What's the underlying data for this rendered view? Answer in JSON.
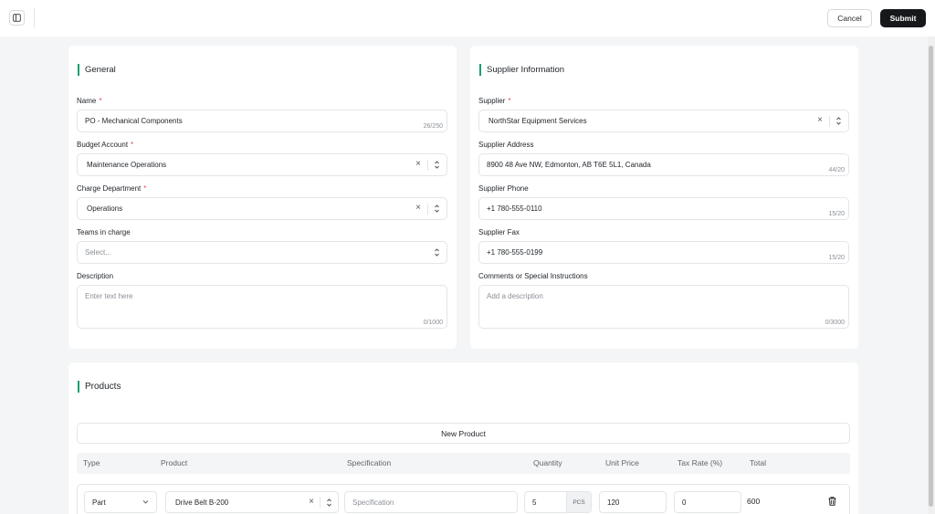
{
  "toolbar": {
    "cancel_label": "Cancel",
    "submit_label": "Submit"
  },
  "general": {
    "title": "General",
    "name": {
      "label": "Name",
      "value": "PO - Mechanical Components",
      "counter": "26/250"
    },
    "budget_account": {
      "label": "Budget Account",
      "value": "Maintenance Operations"
    },
    "charge_department": {
      "label": "Charge Department",
      "value": "Operations"
    },
    "teams": {
      "label": "Teams in charge",
      "placeholder": "Select..."
    },
    "description": {
      "label": "Description",
      "placeholder": "Enter text here",
      "counter": "0/1000"
    }
  },
  "supplier": {
    "title": "Supplier Information",
    "supplier": {
      "label": "Supplier",
      "value": "NorthStar Equipment Services"
    },
    "address": {
      "label": "Supplier Address",
      "value": "8900 48 Ave NW, Edmonton, AB T6E 5L1, Canada",
      "counter": "44/20"
    },
    "phone": {
      "label": "Supplier Phone",
      "value": "+1 780-555-0110",
      "counter": "15/20"
    },
    "fax": {
      "label": "Supplier Fax",
      "value": "+1 780-555-0199",
      "counter": "15/20"
    },
    "comments": {
      "label": "Comments or Special Instructions",
      "placeholder": "Add a description",
      "counter": "0/3000"
    }
  },
  "products": {
    "title": "Products",
    "new_product_label": "New Product",
    "columns": [
      "Type",
      "Product",
      "Specification",
      "Quantity",
      "Unit Price",
      "Tax Rate (%)",
      "Total"
    ],
    "rows": [
      {
        "type": "Part",
        "product": "Drive Belt B-200",
        "specification_placeholder": "Specification",
        "quantity": "5",
        "unit": "PCS",
        "unit_price": "120",
        "tax_rate": "0",
        "total": "600"
      }
    ]
  },
  "colors": {
    "accent": "#1a9e6e",
    "required": "#e5484d",
    "primary_button": "#16181b"
  },
  "icons": [
    "sidebar-toggle-icon",
    "clear-icon",
    "chevron-updown-icon",
    "chevron-down-icon",
    "trash-icon"
  ]
}
